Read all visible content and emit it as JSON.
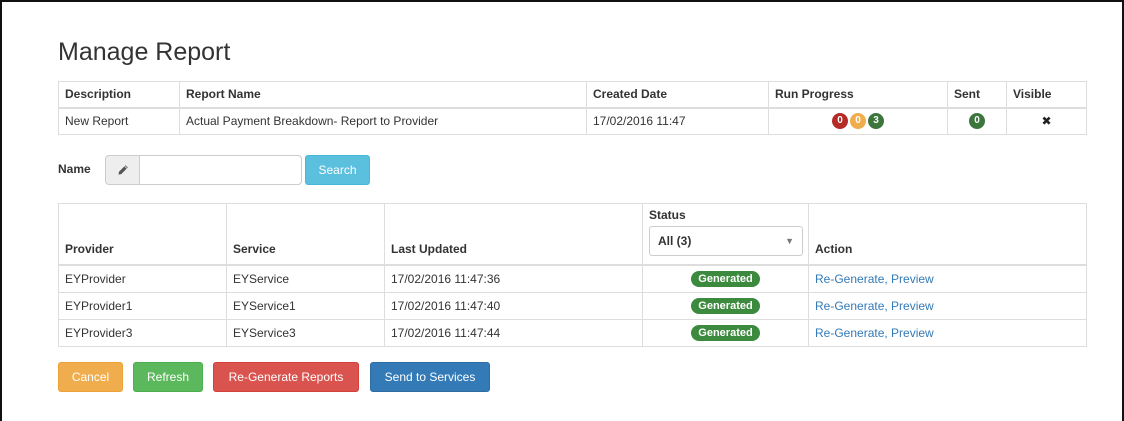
{
  "page": {
    "title": "Manage Report"
  },
  "report_table": {
    "headers": {
      "description": "Description",
      "report_name": "Report Name",
      "created_date": "Created Date",
      "run_progress": "Run Progress",
      "sent": "Sent",
      "visible": "Visible"
    },
    "row": {
      "description": "New Report",
      "report_name": "Actual Payment Breakdown- Report to Provider",
      "created_date": "17/02/2016 11:47",
      "progress_badges": [
        {
          "value": "0",
          "color": "#b52b27"
        },
        {
          "value": "0",
          "color": "#f0ad4e"
        },
        {
          "value": "3",
          "color": "#3c763d"
        }
      ],
      "sent_badge": {
        "value": "0",
        "color": "#3c763d"
      },
      "visible_glyph": "✖"
    }
  },
  "search": {
    "label": "Name",
    "input_value": "",
    "placeholder": "",
    "button_label": "Search"
  },
  "provider_table": {
    "headers": {
      "provider": "Provider",
      "service": "Service",
      "last_updated": "Last Updated",
      "status": "Status",
      "action": "Action"
    },
    "status_filter": {
      "selected": "All (3)"
    },
    "rows": [
      {
        "provider": "EYProvider",
        "service": "EYService",
        "last_updated": "17/02/2016 11:47:36",
        "status": "Generated",
        "action": "Re-Generate, Preview"
      },
      {
        "provider": "EYProvider1",
        "service": "EYService1",
        "last_updated": "17/02/2016 11:47:40",
        "status": "Generated",
        "action": "Re-Generate, Preview"
      },
      {
        "provider": "EYProvider3",
        "service": "EYService3",
        "last_updated": "17/02/2016 11:47:44",
        "status": "Generated",
        "action": "Re-Generate, Preview"
      }
    ]
  },
  "buttons": {
    "cancel": "Cancel",
    "refresh": "Refresh",
    "regenerate": "Re-Generate Reports",
    "send": "Send to Services"
  },
  "icons": {
    "edit": "pencil-icon",
    "status_dropdown": "caret-down-icon",
    "visible": "cross-icon"
  }
}
